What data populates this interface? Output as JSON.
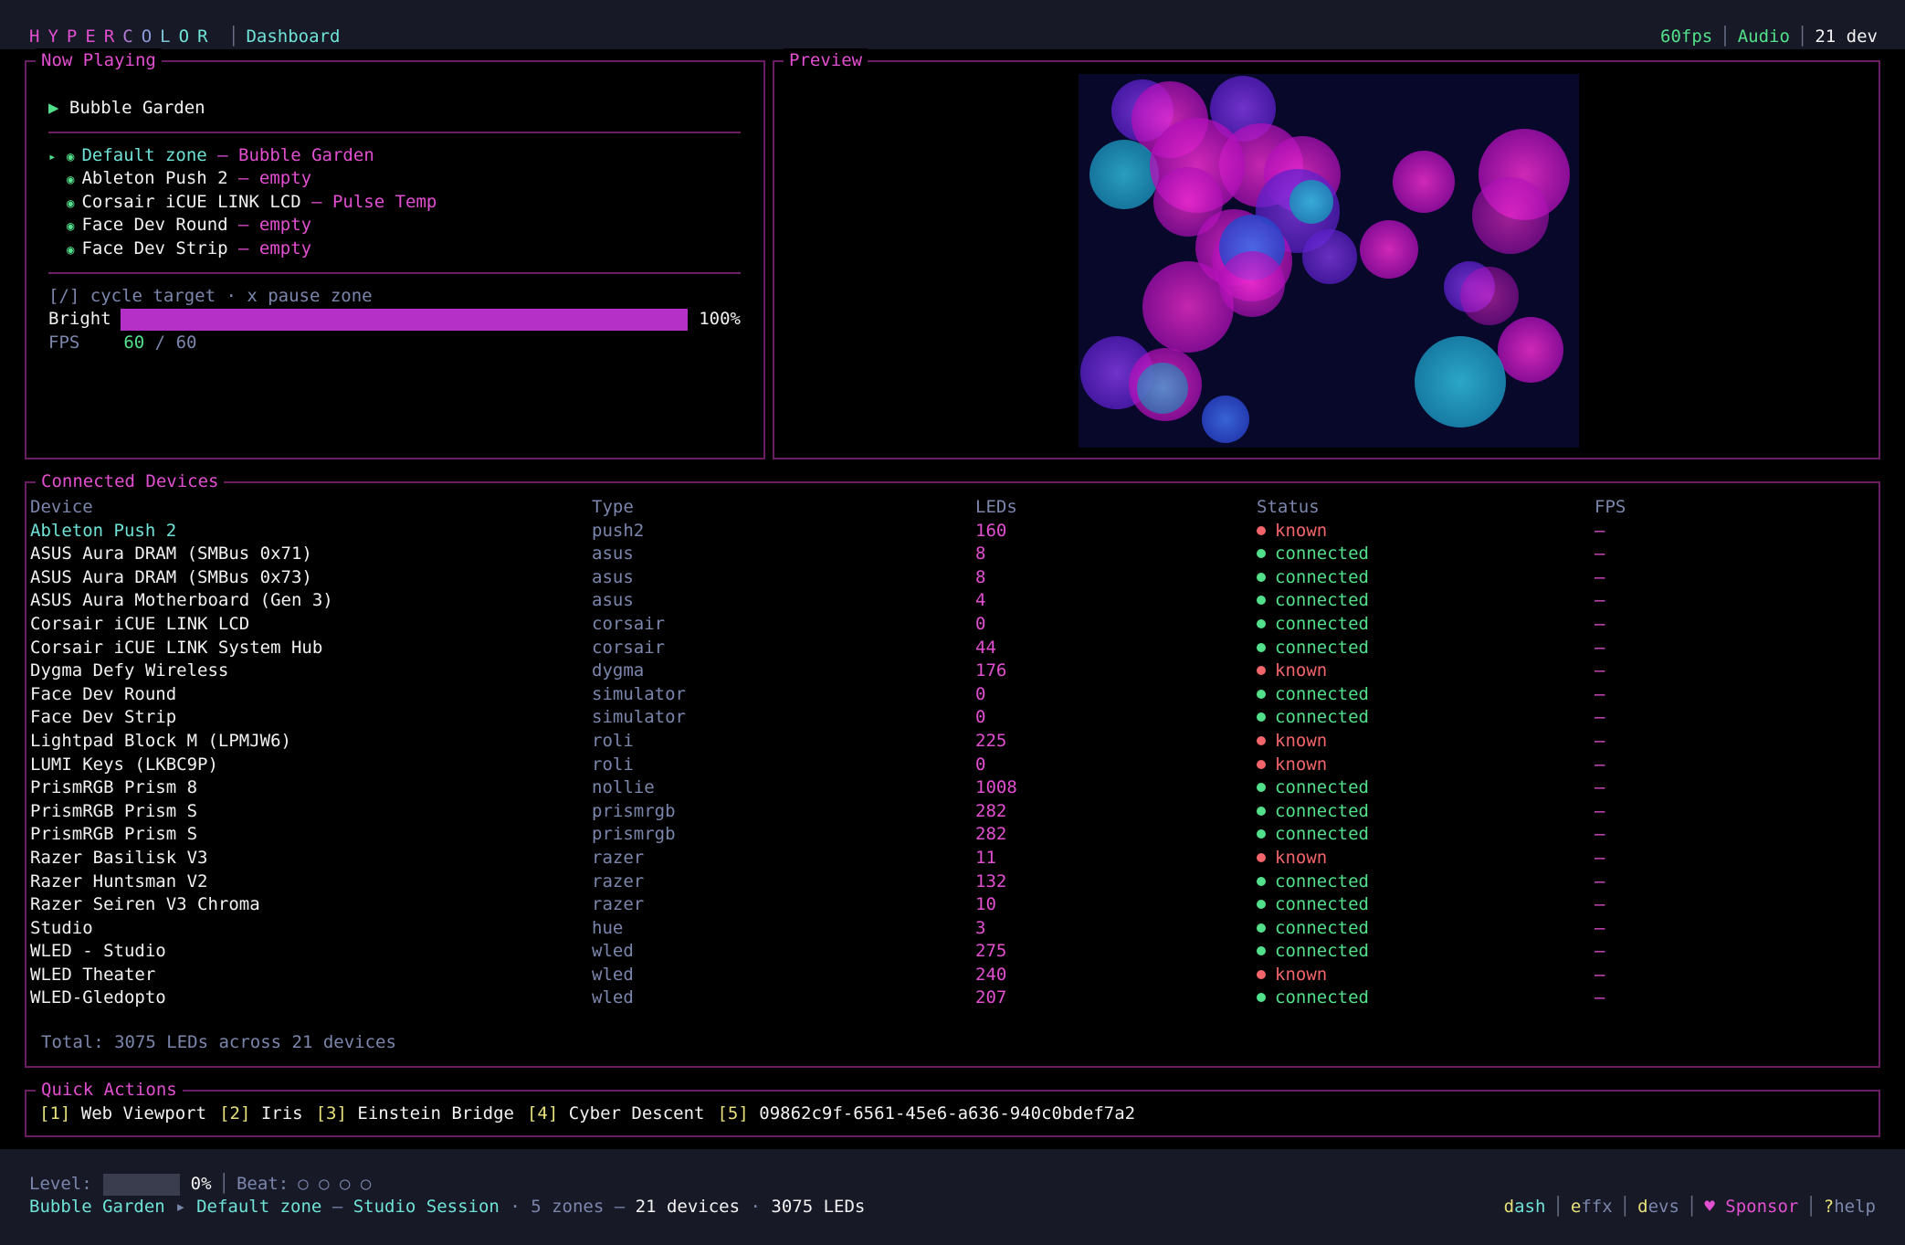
{
  "app": {
    "brand_letters": [
      {
        "ch": "H",
        "color": "#e34fd1"
      },
      {
        "ch": "Y",
        "color": "#e34fd1"
      },
      {
        "ch": "P",
        "color": "#e34fd1"
      },
      {
        "ch": "E",
        "color": "#e34fd1"
      },
      {
        "ch": "R",
        "color": "#e34fd1"
      },
      {
        "ch": "C",
        "color": "#b07ad6"
      },
      {
        "ch": "O",
        "color": "#8c9ad8"
      },
      {
        "ch": "L",
        "color": "#7fc7d8"
      },
      {
        "ch": "O",
        "color": "#6fe3d8"
      },
      {
        "ch": "R",
        "color": "#6fe3d8"
      }
    ],
    "breadcrumb": "Dashboard",
    "fps": "60fps",
    "audio": "Audio",
    "dev_count": "21 dev"
  },
  "now_playing": {
    "title": "Now Playing",
    "effect_marker": "▶",
    "effect_name": "Bubble Garden",
    "zones": [
      {
        "marker": "▸",
        "name": "Default zone",
        "effect": "Bubble Garden",
        "active": true
      },
      {
        "marker": "",
        "name": "Ableton Push 2",
        "effect": "empty",
        "active": false
      },
      {
        "marker": "",
        "name": "Corsair iCUE LINK LCD",
        "effect": "Pulse Temp",
        "active": false
      },
      {
        "marker": "",
        "name": "Face Dev Round",
        "effect": "empty",
        "active": false
      },
      {
        "marker": "",
        "name": "Face Dev Strip",
        "effect": "empty",
        "active": false
      }
    ],
    "hint": "[/] cycle target · x pause zone",
    "bright_label": "Bright",
    "bright_value": 100,
    "bright_text": "100%",
    "fps_label": "FPS",
    "fps_current": "60",
    "fps_sep": "/",
    "fps_target": "60"
  },
  "preview": {
    "title": "Preview"
  },
  "devices": {
    "title": "Connected Devices",
    "columns": [
      "Device",
      "Type",
      "LEDs",
      "Status",
      "FPS"
    ],
    "rows": [
      {
        "name": "Ableton Push 2",
        "type": "push2",
        "leds": "160",
        "status": "known",
        "fps": "–",
        "selected": true
      },
      {
        "name": "ASUS Aura DRAM (SMBus 0x71)",
        "type": "asus",
        "leds": "8",
        "status": "connected",
        "fps": "–"
      },
      {
        "name": "ASUS Aura DRAM (SMBus 0x73)",
        "type": "asus",
        "leds": "8",
        "status": "connected",
        "fps": "–"
      },
      {
        "name": "ASUS Aura Motherboard (Gen 3)",
        "type": "asus",
        "leds": "4",
        "status": "connected",
        "fps": "–"
      },
      {
        "name": "Corsair iCUE LINK LCD",
        "type": "corsair",
        "leds": "0",
        "status": "connected",
        "fps": "–"
      },
      {
        "name": "Corsair iCUE LINK System Hub",
        "type": "corsair",
        "leds": "44",
        "status": "connected",
        "fps": "–"
      },
      {
        "name": "Dygma Defy Wireless",
        "type": "dygma",
        "leds": "176",
        "status": "known",
        "fps": "–"
      },
      {
        "name": "Face Dev Round",
        "type": "simulator",
        "leds": "0",
        "status": "connected",
        "fps": "–"
      },
      {
        "name": "Face Dev Strip",
        "type": "simulator",
        "leds": "0",
        "status": "connected",
        "fps": "–"
      },
      {
        "name": "Lightpad Block M (LPMJW6)",
        "type": "roli",
        "leds": "225",
        "status": "known",
        "fps": "–"
      },
      {
        "name": "LUMI Keys (LKBC9P)",
        "type": "roli",
        "leds": "0",
        "status": "known",
        "fps": "–"
      },
      {
        "name": "PrismRGB Prism 8",
        "type": "nollie",
        "leds": "1008",
        "status": "connected",
        "fps": "–"
      },
      {
        "name": "PrismRGB Prism S",
        "type": "prismrgb",
        "leds": "282",
        "status": "connected",
        "fps": "–"
      },
      {
        "name": "PrismRGB Prism S",
        "type": "prismrgb",
        "leds": "282",
        "status": "connected",
        "fps": "–"
      },
      {
        "name": "Razer Basilisk V3",
        "type": "razer",
        "leds": "11",
        "status": "known",
        "fps": "–"
      },
      {
        "name": "Razer Huntsman V2",
        "type": "razer",
        "leds": "132",
        "status": "connected",
        "fps": "–"
      },
      {
        "name": "Razer Seiren V3 Chroma",
        "type": "razer",
        "leds": "10",
        "status": "connected",
        "fps": "–"
      },
      {
        "name": "Studio",
        "type": "hue",
        "leds": "3",
        "status": "connected",
        "fps": "–"
      },
      {
        "name": "WLED - Studio",
        "type": "wled",
        "leds": "275",
        "status": "connected",
        "fps": "–"
      },
      {
        "name": "WLED Theater",
        "type": "wled",
        "leds": "240",
        "status": "known",
        "fps": "–"
      },
      {
        "name": "WLED-Gledopto",
        "type": "wled",
        "leds": "207",
        "status": "connected",
        "fps": "–"
      }
    ],
    "total": "Total: 3075 LEDs across 21 devices"
  },
  "quick_actions": {
    "title": "Quick Actions",
    "items": [
      {
        "key": "[1]",
        "label": "Web Viewport"
      },
      {
        "key": "[2]",
        "label": "Iris"
      },
      {
        "key": "[3]",
        "label": "Einstein Bridge"
      },
      {
        "key": "[4]",
        "label": "Cyber Descent"
      },
      {
        "key": "[5]",
        "label": "09862c9f-6561-45e6-a636-940c0bdef7a2"
      }
    ]
  },
  "statusbar": {
    "level_label": "Level:",
    "level_value": 0,
    "level_text": "0%",
    "beat_label": "Beat:",
    "beat_dots": "○ ○ ○ ○",
    "effect": "Bubble Garden",
    "arrow": "▸",
    "zone": "Default zone",
    "dash1": "—",
    "session": "Studio Session",
    "dot1": "·",
    "zones": "5 zones",
    "dash2": "—",
    "devices": "21 devices",
    "dot2": "·",
    "leds": "3075 LEDs",
    "nav": [
      {
        "hot": "d",
        "rest": "ash",
        "active": true
      },
      {
        "hot": "e",
        "rest": "ffx",
        "active": false
      },
      {
        "hot": "d",
        "rest": "evs",
        "active": false
      }
    ],
    "sponsor_icon": "♥",
    "sponsor": "Sponsor",
    "help_key": "?",
    "help": "help"
  },
  "colors": {
    "accent_pink": "#e34fd1",
    "accent_cyan": "#6fe3d8",
    "status_connected": "#52e08b",
    "status_known": "#f2656a",
    "border": "#6a1d62",
    "bar_fill": "#b430c6"
  }
}
